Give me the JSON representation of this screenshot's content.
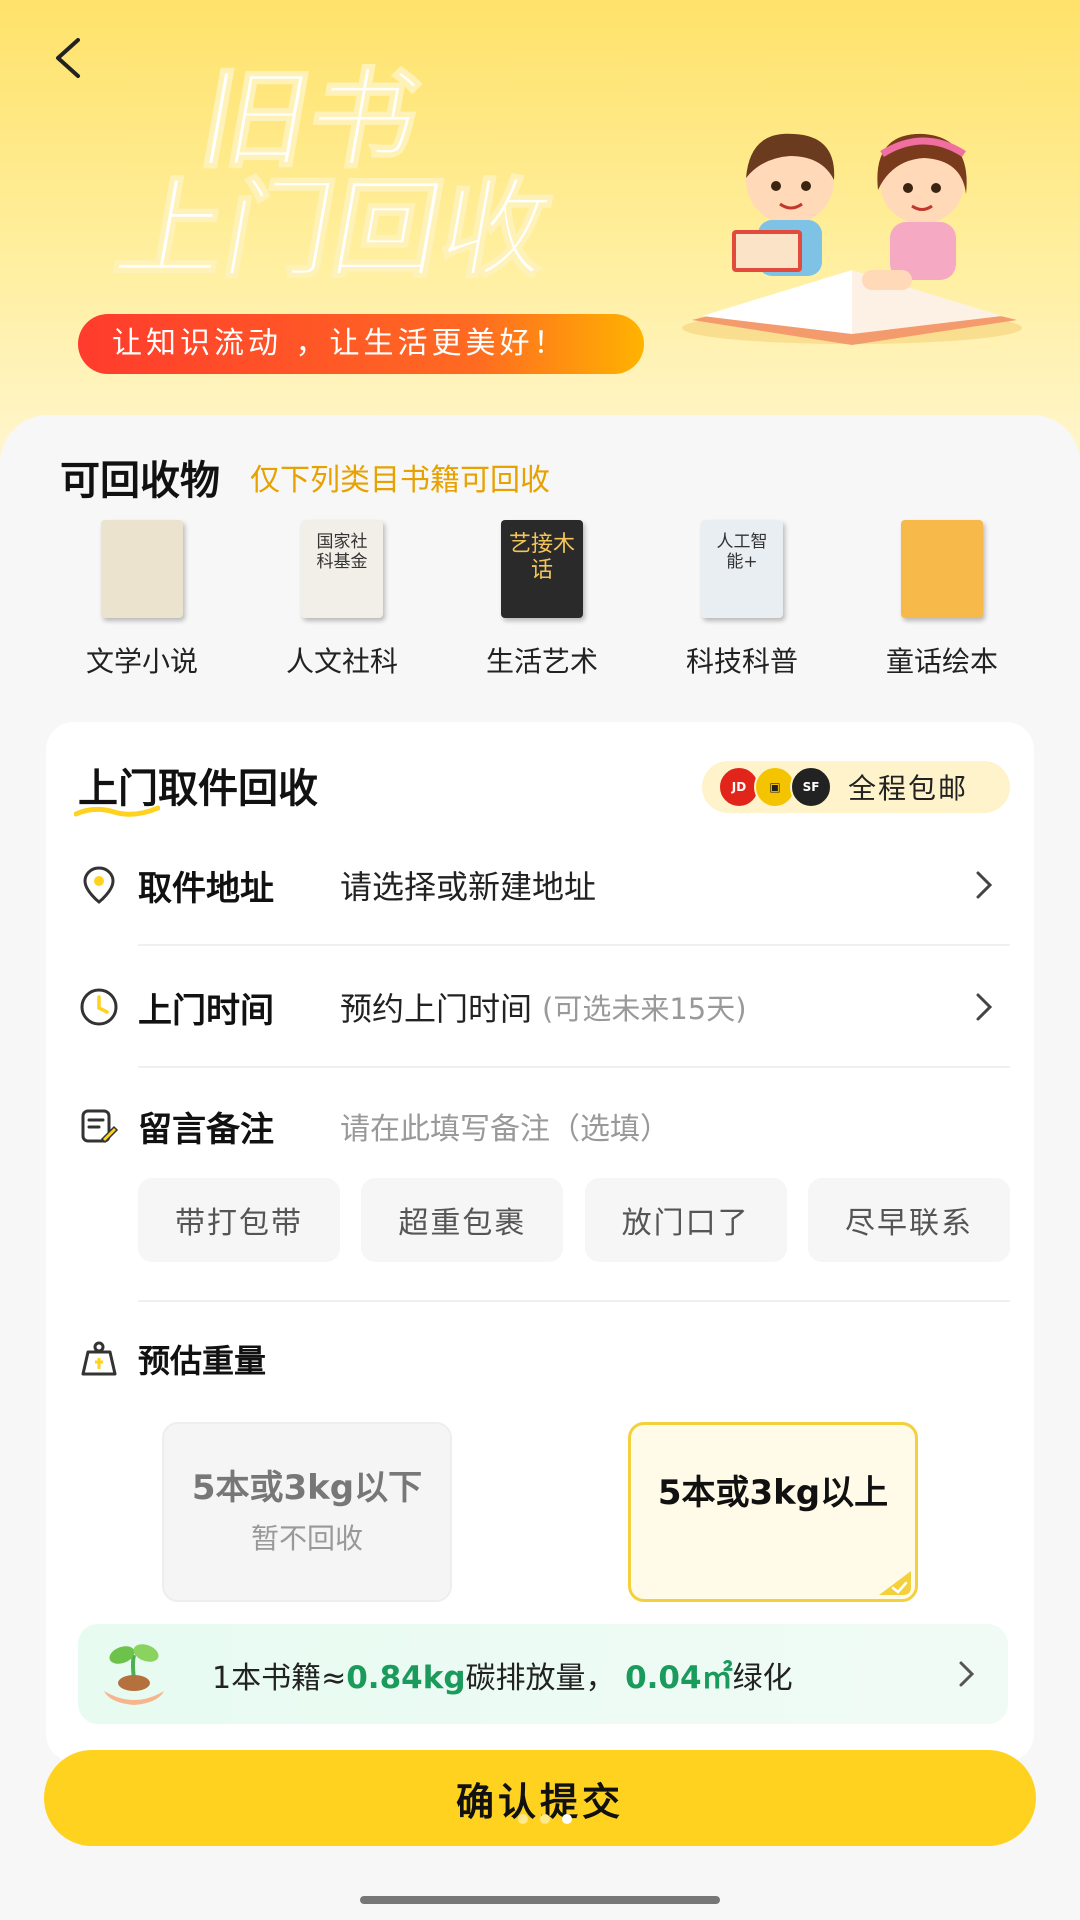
{
  "header": {
    "back_icon": "chevron-left-icon",
    "title_line1": "旧书",
    "title_line2": "上门回收",
    "slogan": "让知识流动 ，让生活更美好！"
  },
  "categories": {
    "title": "可回收物",
    "subtitle": "仅下列类目书籍可回收",
    "items": [
      {
        "label": "文学小说",
        "cover_text": "",
        "cover_color": "#ece3cf",
        "text_color": "#6b3c1e"
      },
      {
        "label": "人文社科",
        "cover_text": "国家社科基金",
        "cover_color": "#f1efe8",
        "text_color": "#333333"
      },
      {
        "label": "生活艺术",
        "cover_text": "艺接木话",
        "cover_color": "#2a2a2a",
        "text_color": "#f2c45a"
      },
      {
        "label": "科技科普",
        "cover_text": "人工智能+",
        "cover_color": "#e9eef3",
        "text_color": "#333333"
      },
      {
        "label": "童话绘本",
        "cover_text": "",
        "cover_color": "#f6b94a",
        "text_color": "#b3261e"
      }
    ]
  },
  "pickup": {
    "title": "上门取件回收",
    "shipping_badge": "全程包邮",
    "address": {
      "label": "取件地址",
      "value": "请选择或新建地址",
      "icon": "location-pin-icon"
    },
    "time": {
      "label": "上门时间",
      "value": "预约上门时间",
      "hint": "(可选未来15天)",
      "icon": "clock-icon"
    },
    "note": {
      "label": "留言备注",
      "placeholder": "请在此填写备注（选填）",
      "icon": "note-edit-icon"
    },
    "quick_tags": [
      "带打包带",
      "超重包裹",
      "放门口了",
      "尽早联系"
    ]
  },
  "weight": {
    "label": "预估重量",
    "icon": "weight-icon",
    "options": [
      {
        "title": "5本或3kg以下",
        "subtitle": "暂不回收",
        "selected": false
      },
      {
        "title": "5本或3kg以上",
        "subtitle": "",
        "selected": true
      }
    ]
  },
  "eco": {
    "prefix": "1本书籍≈",
    "carbon_value": "0.84kg",
    "carbon_label": "碳排放量，",
    "green_value": "0.04㎡",
    "green_label": "绿化"
  },
  "submit_label": "确认提交",
  "colors": {
    "accent": "#ffd21f",
    "highlight": "#e7a100",
    "eco_green": "#1a9b5c"
  }
}
